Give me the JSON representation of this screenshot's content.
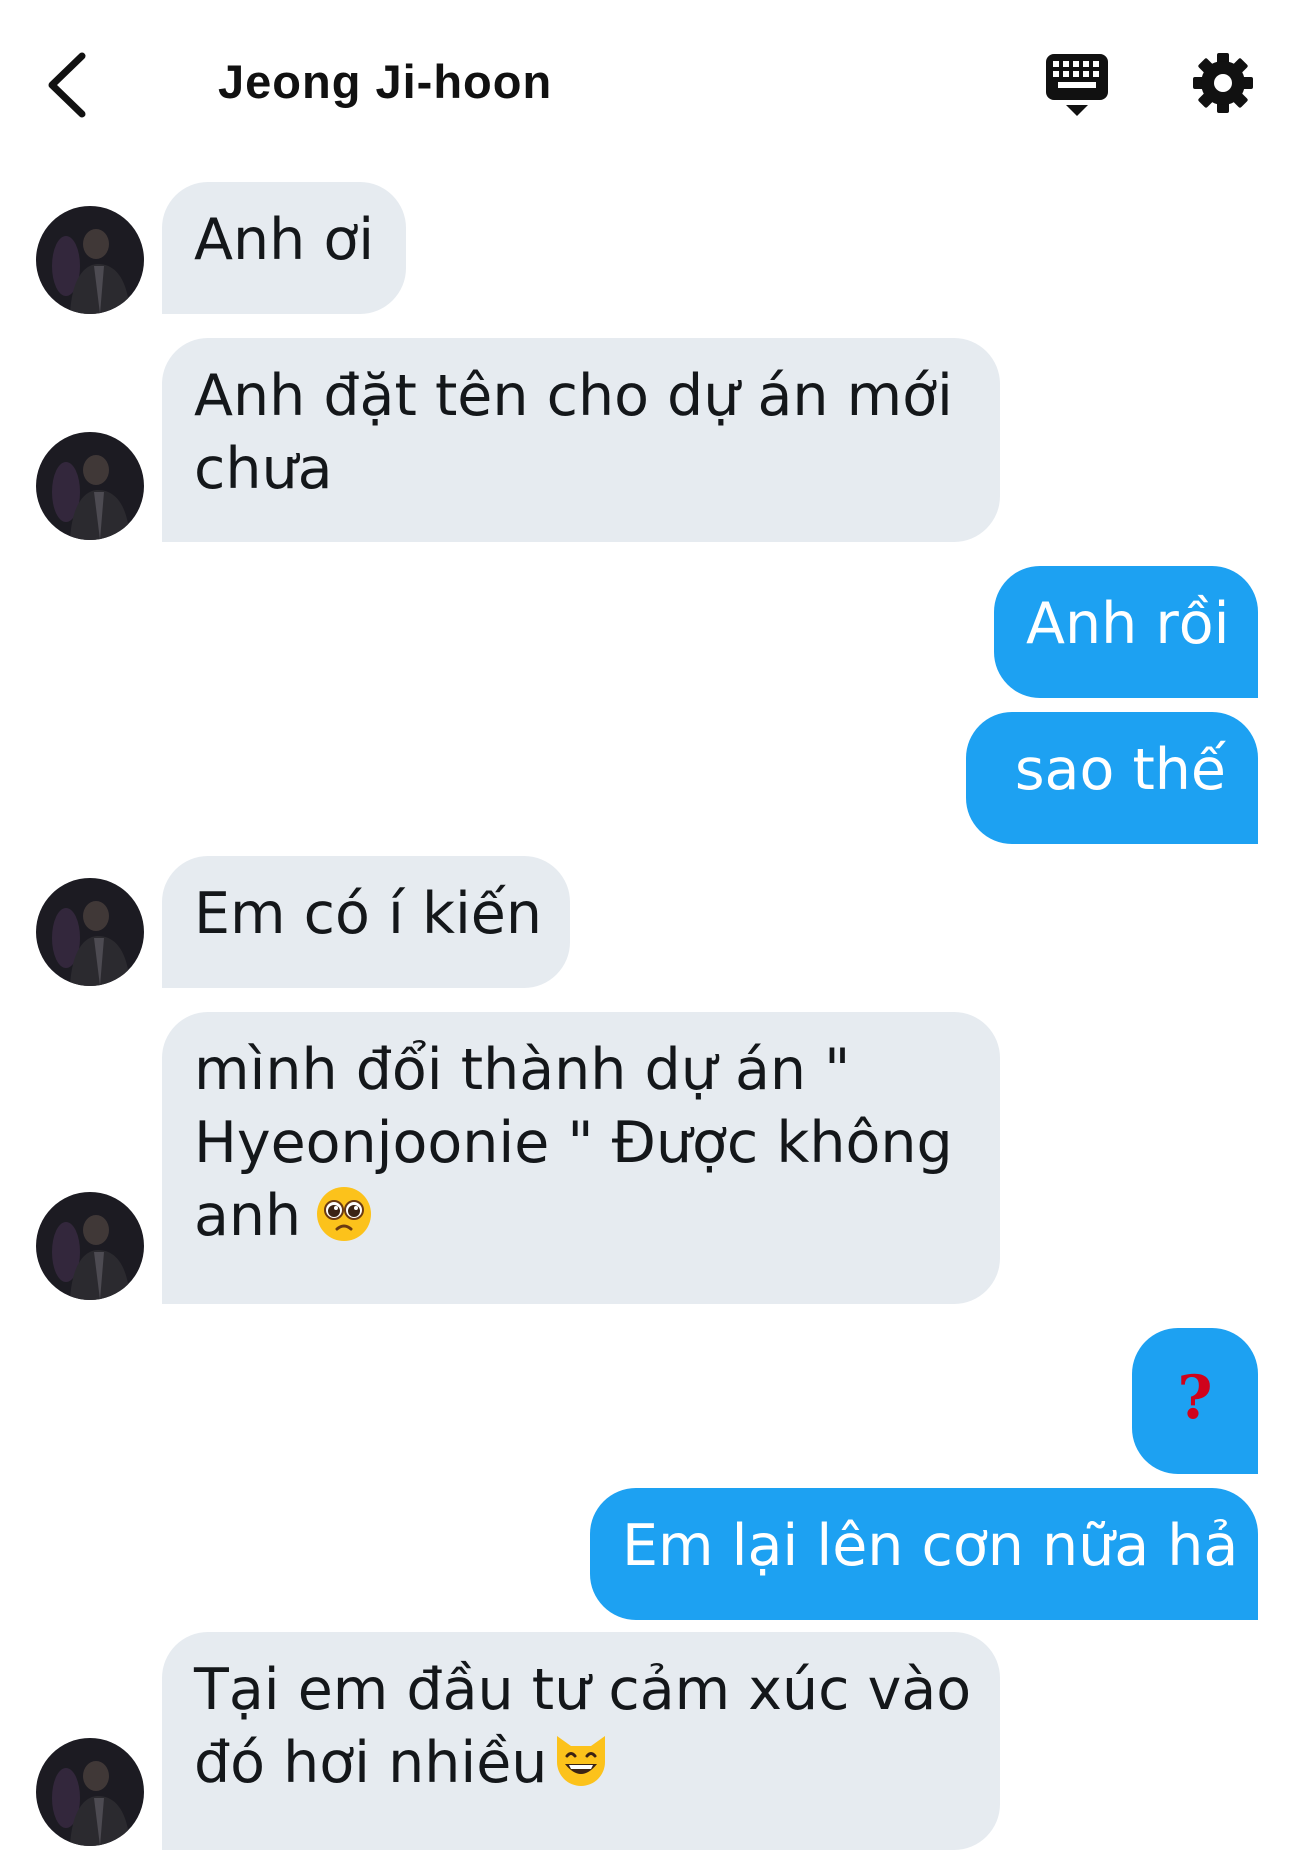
{
  "header": {
    "title": "Jeong Ji-hoon",
    "back_icon": "chevron-left-icon",
    "keyboard_icon": "keyboard-icon",
    "settings_icon": "gear-icon"
  },
  "colors": {
    "incoming_bubble": "#e6ebf0",
    "outgoing_bubble": "#1da1f2",
    "question_mark": "#d0021b"
  },
  "messages": [
    {
      "sender": "other",
      "lines": [
        "Anh ơi"
      ]
    },
    {
      "sender": "other",
      "lines": [
        "Anh đặt tên cho dự án mới",
        "chưa"
      ]
    },
    {
      "sender": "me",
      "lines": [
        "Anh rồi"
      ]
    },
    {
      "sender": "me",
      "lines": [
        "sao thế"
      ]
    },
    {
      "sender": "other",
      "lines": [
        "Em có í kiến"
      ]
    },
    {
      "sender": "other",
      "lines": [
        "mình đổi thành dự án \"",
        "Hyeonjoonie \" Được không",
        "anh"
      ],
      "emoji": "pleading-face-emoji"
    },
    {
      "sender": "me",
      "lines": [
        "?"
      ]
    },
    {
      "sender": "me",
      "lines": [
        "Em lại lên cơn nữa hả"
      ]
    },
    {
      "sender": "other",
      "lines": [
        "Tại em đầu tư cảm xúc vào",
        "đó hơi nhiều"
      ],
      "emoji": "grinning-cat-emoji"
    }
  ]
}
